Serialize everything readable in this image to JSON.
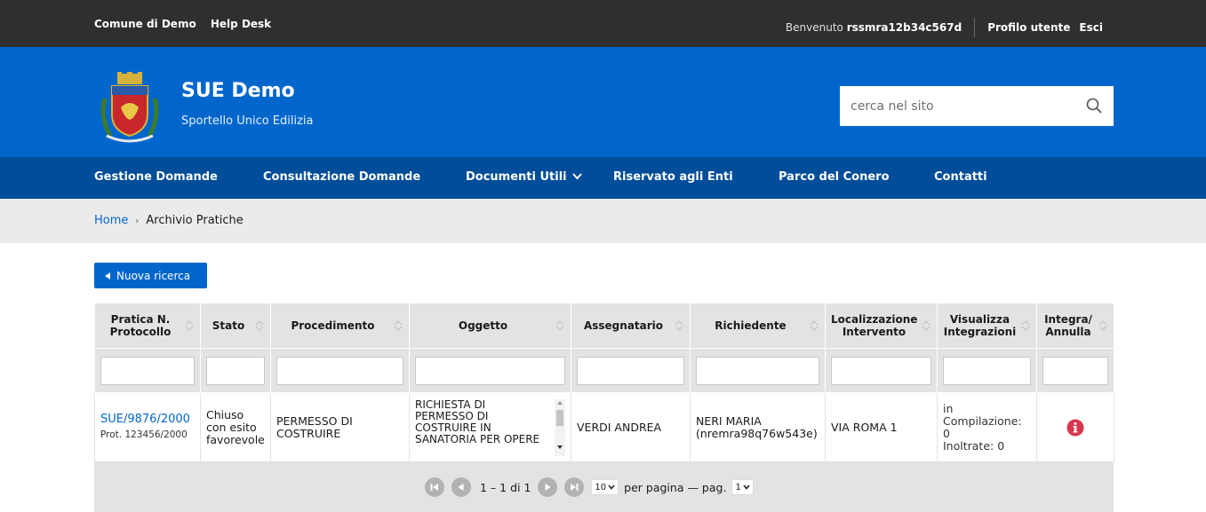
{
  "topbar": {
    "links": [
      "Comune di Demo",
      "Help Desk"
    ],
    "welcome_prefix": "Benvenuto",
    "username": "rssmra12b34c567d",
    "profile": "Profilo utente",
    "logout": "Esci"
  },
  "header": {
    "title": "SUE Demo",
    "subtitle": "Sportello Unico Edilizia",
    "search_placeholder": "cerca nel sito"
  },
  "nav": {
    "items": [
      "Gestione Domande",
      "Consultazione Domande",
      "Documenti Utili",
      "Riservato agli Enti",
      "Parco del Conero",
      "Contatti"
    ]
  },
  "breadcrumb": {
    "home": "Home",
    "separator": "›",
    "current": "Archivio Pratiche"
  },
  "actions": {
    "new_search": "Nuova ricerca"
  },
  "table": {
    "columns": [
      {
        "l1": "Pratica N.",
        "l2": "Protocollo"
      },
      {
        "l1": "Stato",
        "l2": ""
      },
      {
        "l1": "Procedimento",
        "l2": ""
      },
      {
        "l1": "Oggetto",
        "l2": ""
      },
      {
        "l1": "Assegnatario",
        "l2": ""
      },
      {
        "l1": "Richiedente",
        "l2": ""
      },
      {
        "l1": "Localizzazione",
        "l2": "Intervento"
      },
      {
        "l1": "Visualizza",
        "l2": "Integrazioni"
      },
      {
        "l1": "Integra/",
        "l2": "Annulla"
      }
    ],
    "rows": [
      {
        "pratica": "SUE/9876/2000",
        "protocollo": "Prot. 123456/2000",
        "stato": [
          "Chiuso",
          "con esito",
          "favorevole"
        ],
        "procedimento": [
          "PERMESSO DI",
          "COSTRUIRE"
        ],
        "oggetto": [
          "RICHIESTA DI",
          "PERMESSO DI",
          "COSTRUIRE IN",
          "SANATORIA PER OPERE"
        ],
        "assegnatario": "VERDI ANDREA",
        "richiedente": [
          "NERI MARIA",
          "(nremra98q76w543e)"
        ],
        "localizzazione": "VIA ROMA 1",
        "integrazioni": [
          "in Compilazione: 0",
          "Inoltrate: 0"
        ],
        "icon": "info-icon"
      }
    ]
  },
  "pager": {
    "range": "1 – 1 di 1",
    "per_page_value": "10",
    "per_page_label": "per pagina — pag.",
    "page_value": "1"
  },
  "colors": {
    "topbar": "#2f2f2f",
    "header": "#0066cc",
    "nav": "#004d99",
    "accent": "#0066cc",
    "danger": "#d9364f"
  }
}
